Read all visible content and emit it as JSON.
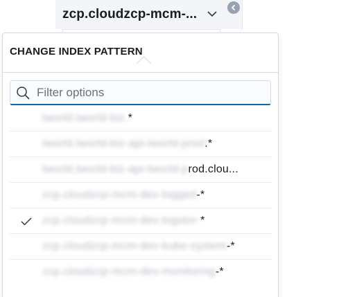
{
  "index_selector": {
    "label": "zcp.cloudzcp-mcm-..."
  },
  "popover": {
    "title": "CHANGE INDEX PATTERN",
    "search": {
      "placeholder": "Filter options",
      "value": ""
    },
    "options": [
      {
        "blurred": "tworld.tworld-biz.",
        "visible": "*",
        "selected": false
      },
      {
        "blurred": "tworld.tworld-biz-api-tworld-prod",
        "visible": ".*",
        "selected": false
      },
      {
        "blurred": "tworld.tworld-biz-api-tworld-p",
        "visible": "rod.clou...",
        "selected": false
      },
      {
        "blurred": "zcp.cloudzcp-mcm-dev-logged",
        "visible": "-*",
        "selected": false
      },
      {
        "blurred": "zcp.cloudzcp-mcm-dev-logstor-",
        "visible": "*",
        "selected": true
      },
      {
        "blurred": "zcp.cloudzcp-mcm-dev-kube-system",
        "visible": "-*",
        "selected": false
      },
      {
        "blurred": "zcp.cloudzcp-mcm-dev-monitoring",
        "visible": "-*",
        "selected": false
      }
    ]
  },
  "colors": {
    "accent": "#006bb8",
    "border": "#d3dae6",
    "text": "#1a1c21",
    "muted": "#69707d"
  }
}
